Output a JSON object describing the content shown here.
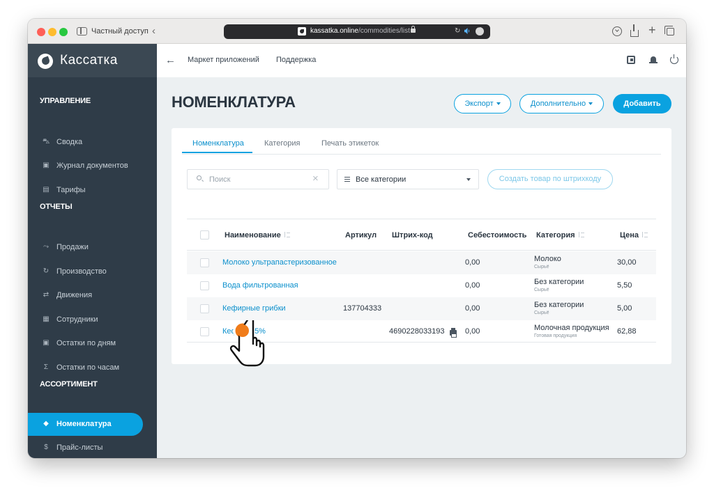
{
  "browser": {
    "private_label": "Частный доступ",
    "url_domain": "kassatka.online",
    "url_path": "/commodities/list"
  },
  "brand": {
    "name": "Кассатка"
  },
  "sidebar": {
    "sections": [
      {
        "title": "УПРАВЛЕНИЕ",
        "items": [
          {
            "label": "Сводка",
            "icon": "cart-icon"
          },
          {
            "label": "Журнал документов",
            "icon": "calendar-icon"
          },
          {
            "label": "Тарифы",
            "icon": "card-icon"
          }
        ]
      },
      {
        "title": "ОТЧЕТЫ",
        "items": [
          {
            "label": "Продажи",
            "icon": "trend-icon"
          },
          {
            "label": "Производство",
            "icon": "refresh-icon"
          },
          {
            "label": "Движения",
            "icon": "arrows-icon"
          },
          {
            "label": "Сотрудники",
            "icon": "people-icon"
          },
          {
            "label": "Остатки по дням",
            "icon": "calendar-icon"
          },
          {
            "label": "Остатки по часам",
            "icon": "sigma-icon"
          }
        ]
      },
      {
        "title": "АССОРТИМЕНТ",
        "items": [
          {
            "label": "Номенклатура",
            "icon": "tag-icon",
            "active": true
          },
          {
            "label": "Прайс-листы",
            "icon": "dollar-icon"
          }
        ]
      }
    ]
  },
  "header": {
    "links": [
      "Маркет приложений",
      "Поддержка"
    ]
  },
  "page": {
    "title": "НОМЕНКЛАТУРА",
    "export_label": "Экспорт",
    "more_label": "Дополнительно",
    "add_label": "Добавить"
  },
  "tabs": [
    "Номенклатура",
    "Категория",
    "Печать этикеток"
  ],
  "filters": {
    "search_placeholder": "Поиск",
    "category_value": "Все категории",
    "barcode_button": "Создать товар по штрихкоду"
  },
  "table": {
    "columns": [
      "Наименование",
      "Артикул",
      "Штрих-код",
      "Себестоимость",
      "Категория",
      "Цена"
    ],
    "rows": [
      {
        "name": "Молоко ультрапастеризованное",
        "article": "",
        "barcode": "",
        "cost": "0,00",
        "category": "Молоко",
        "category_sub": "Сырьё",
        "price": "30,00"
      },
      {
        "name": "Вода фильтрованная",
        "article": "",
        "barcode": "",
        "cost": "0,00",
        "category": "Без категории",
        "category_sub": "Сырьё",
        "price": "5,50"
      },
      {
        "name": "Кефирные грибки",
        "article": "137704333",
        "barcode": "",
        "cost": "0,00",
        "category": "Без категории",
        "category_sub": "Сырьё",
        "price": "5,00"
      },
      {
        "name": "Кефир 2,5%",
        "article": "",
        "barcode": "4690228033193",
        "cost": "0,00",
        "category": "Молочная продукция",
        "category_sub": "Готовая продукция",
        "price": "62,88"
      }
    ]
  },
  "colors": {
    "accent": "#0aa2e0",
    "sidebar_bg": "#2f3c48",
    "cursor_dot": "#f07c1a"
  }
}
